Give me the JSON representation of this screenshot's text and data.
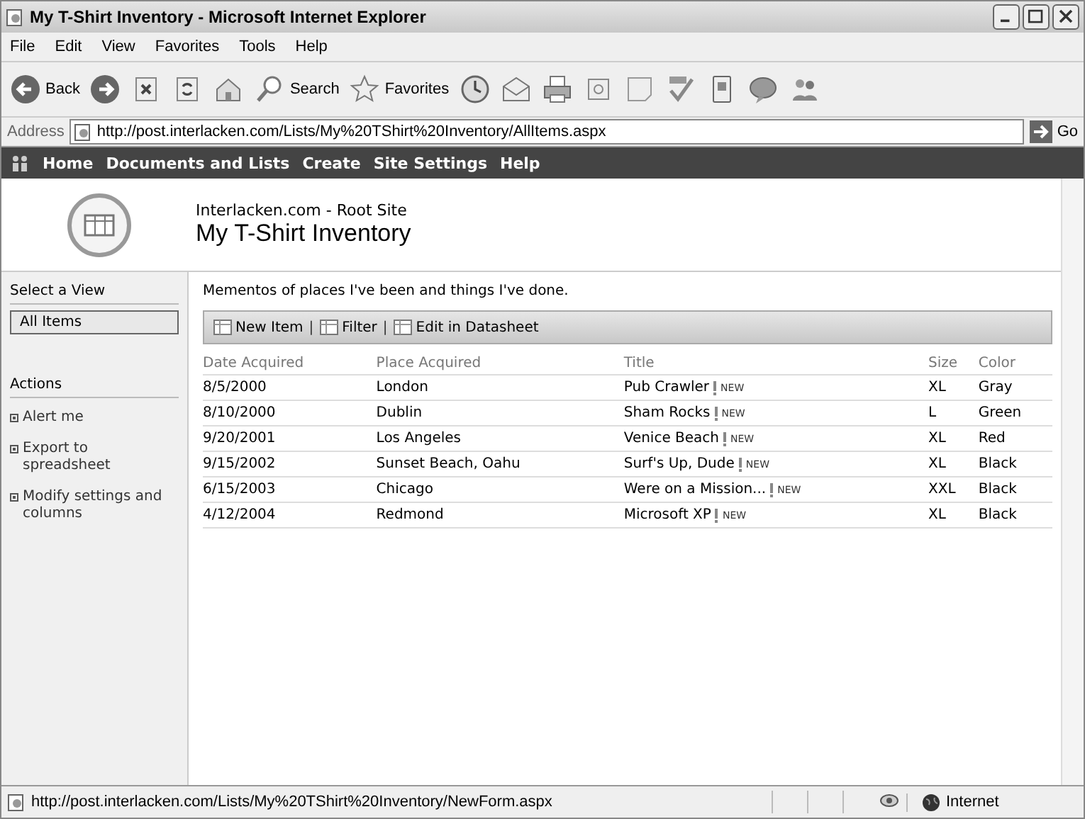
{
  "window": {
    "title": "My T-Shirt Inventory - Microsoft Internet Explorer"
  },
  "menu": [
    "File",
    "Edit",
    "View",
    "Favorites",
    "Tools",
    "Help"
  ],
  "toolbar": [
    {
      "kind": "back",
      "label": "Back"
    },
    {
      "kind": "forward"
    },
    {
      "kind": "stop"
    },
    {
      "kind": "refresh"
    },
    {
      "kind": "home"
    },
    {
      "kind": "search",
      "label": "Search"
    },
    {
      "kind": "favorites",
      "label": "Favorites"
    },
    {
      "kind": "history"
    },
    {
      "kind": "mail"
    },
    {
      "kind": "print"
    },
    {
      "kind": "edit"
    },
    {
      "kind": "note"
    },
    {
      "kind": "spelling"
    },
    {
      "kind": "device"
    },
    {
      "kind": "chat"
    },
    {
      "kind": "people"
    }
  ],
  "address": {
    "label": "Address",
    "value": "http://post.interlacken.com/Lists/My%20TShirt%20Inventory/AllItems.aspx",
    "go": "Go"
  },
  "nav": [
    "Home",
    "Documents and Lists",
    "Create",
    "Site Settings",
    "Help"
  ],
  "header": {
    "site": "Interlacken.com - Root Site",
    "title": "My T-Shirt Inventory"
  },
  "sidebar": {
    "view_heading": "Select a View",
    "views": [
      {
        "label": "All Items",
        "selected": true
      }
    ],
    "actions_heading": "Actions",
    "actions": [
      "Alert me",
      "Export to spreadsheet",
      "Modify settings and columns"
    ]
  },
  "description": "Mementos of places I've been and things I've done.",
  "list_toolbar": {
    "items": [
      "New Item",
      "Filter",
      "Edit in Datasheet"
    ],
    "separator": "|"
  },
  "table": {
    "columns": [
      "Date Acquired",
      "Place Acquired",
      "Title",
      "Size",
      "Color"
    ],
    "rows": [
      {
        "date": "8/5/2000",
        "place": "London",
        "title": "Pub Crawler",
        "badge": "NEW",
        "size": "XL",
        "shirt_color": "Gray"
      },
      {
        "date": "8/10/2000",
        "place": "Dublin",
        "title": "Sham Rocks",
        "badge": "NEW",
        "size": "L",
        "shirt_color": "Green"
      },
      {
        "date": "9/20/2001",
        "place": "Los Angeles",
        "title": "Venice Beach",
        "badge": "NEW",
        "size": "XL",
        "shirt_color": "Red"
      },
      {
        "date": "9/15/2002",
        "place": "Sunset Beach, Oahu",
        "title": "Surf's Up, Dude",
        "badge": "NEW",
        "size": "XL",
        "shirt_color": "Black"
      },
      {
        "date": "6/15/2003",
        "place": "Chicago",
        "title": "Were on a Mission...",
        "badge": "NEW",
        "size": "XXL",
        "shirt_color": "Black"
      },
      {
        "date": "4/12/2004",
        "place": "Redmond",
        "title": "Microsoft XP",
        "badge": "NEW",
        "size": "XL",
        "shirt_color": "Black"
      }
    ]
  },
  "status_bar": {
    "url": "http://post.interlacken.com/Lists/My%20TShirt%20Inventory/NewForm.aspx",
    "zone": "Internet"
  }
}
